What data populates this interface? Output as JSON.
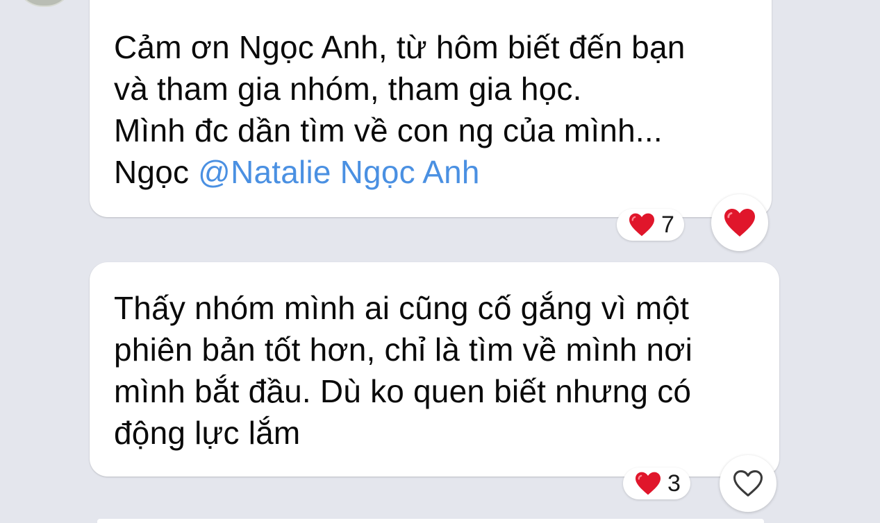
{
  "thread": {
    "messages": [
      {
        "lines": [
          "Cảm ơn Ngọc Anh, từ hôm biết đến bạn",
          "và tham gia nhóm, tham gia học.",
          "Mình đc dần tìm về con ng của mình..."
        ],
        "last_line_prefix": "Ngọc ",
        "mention": "@Natalie Ngọc Anh",
        "reaction": {
          "icon": "heart",
          "count": "7"
        },
        "my_reaction": {
          "icon": "red-heart",
          "active": true
        }
      },
      {
        "lines": [
          "Thấy nhóm mình ai cũng cố gắng vì một",
          "phiên bản tốt hơn, chỉ là tìm về mình nơi",
          "mình bắt đầu. Dù ko quen biết nhưng có",
          "động lực lắm"
        ],
        "reaction": {
          "icon": "heart",
          "count": "3"
        },
        "my_reaction": {
          "icon": "heart-outline",
          "active": false
        }
      }
    ]
  },
  "colors": {
    "background": "#e4e6ed",
    "bubble": "#ffffff",
    "mention": "#4a90e2",
    "heart": "#e0162b"
  }
}
